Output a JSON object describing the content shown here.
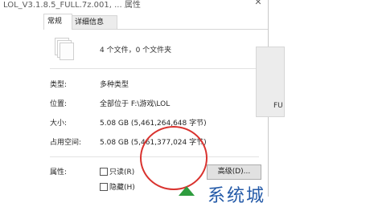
{
  "window": {
    "title": "LOL_V3.1.8.5_FULL.7z.001, ... 属性",
    "close_glyph": "✕"
  },
  "tabs": [
    {
      "label": "常规",
      "active": true
    },
    {
      "label": "详细信息",
      "active": false
    }
  ],
  "summary": "4 个文件，0 个文件夹",
  "rows": {
    "type_label": "类型:",
    "type_value": "多种类型",
    "location_label": "位置:",
    "location_value": "全部位于 F:\\游戏\\LOL",
    "size_label": "大小:",
    "size_value": "5.08 GB (5,461,264,648 字节)",
    "disk_label": "占用空间:",
    "disk_value": "5.08 GB (5,461,377,024 字节)",
    "attributes_label": "属性:"
  },
  "attributes": {
    "readonly_label": "只读(R)",
    "hidden_label": "隐藏(H)",
    "advanced_label": "高级(D)..."
  },
  "background": {
    "partial_label": "FU"
  },
  "colors": {
    "highlight": "#d9322e",
    "watermark": "#245aa8"
  }
}
